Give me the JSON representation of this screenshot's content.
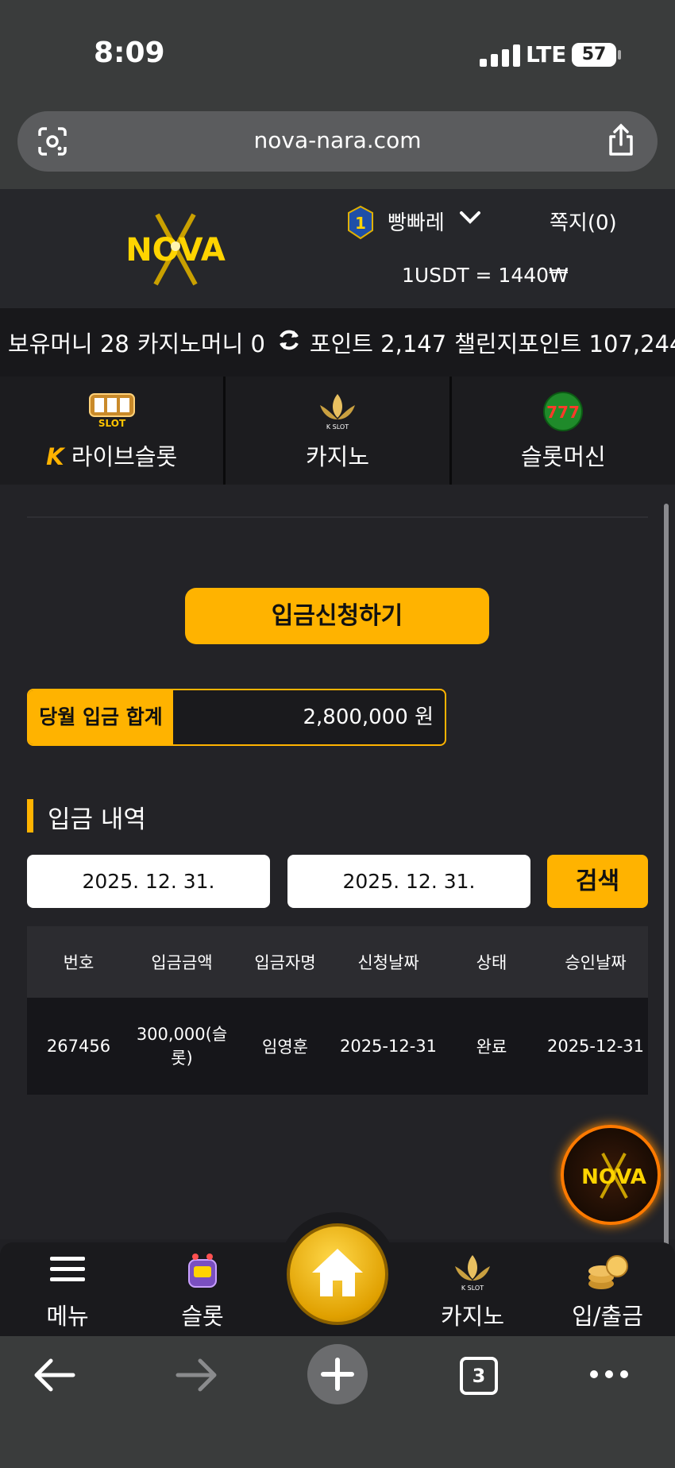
{
  "status": {
    "time": "8:09",
    "network": "LTE",
    "battery": "57"
  },
  "browser": {
    "url": "nova-nara.com",
    "tab_count": "3"
  },
  "header": {
    "logo_text": "NOVA",
    "rank": "1",
    "username": "빵빠레",
    "messages": "쪽지(0)",
    "rate": "1USDT = 1440₩"
  },
  "money": {
    "cash": "보유머니 28",
    "casino": "카지노머니 0",
    "points": "포인트 2,147",
    "challenge": "챌린지포인트 107,244"
  },
  "game_tabs": [
    {
      "label": "라이브슬롯",
      "icon": "live-slot-icon"
    },
    {
      "label": "카지노",
      "icon": "kslot-lotus-icon"
    },
    {
      "label": "슬롯머신",
      "icon": "777-slots-icon"
    }
  ],
  "deposit": {
    "apply_button": "입금신청하기",
    "month_label": "당월 입금 합계",
    "month_total": "2,800,000 원",
    "section_title": "입금 내역",
    "date_from": "2025. 12. 31.",
    "date_to": "2025. 12. 31.",
    "search_button": "검색",
    "table": {
      "headers": [
        "번호",
        "입금금액",
        "입금자명",
        "신청날짜",
        "상태",
        "승인날짜"
      ],
      "rows": [
        [
          "267456",
          "300,000(슬롯)",
          "임영훈",
          "2025-12-31",
          "완료",
          "2025-12-31"
        ]
      ]
    }
  },
  "bottom_nav": [
    {
      "label": "메뉴",
      "icon": "hamburger-icon"
    },
    {
      "label": "슬롯",
      "icon": "slot-machine-icon"
    },
    {
      "label": "",
      "icon": "home-icon"
    },
    {
      "label": "카지노",
      "icon": "kslot-lotus-icon"
    },
    {
      "label": "입/출금",
      "icon": "coins-icon"
    }
  ],
  "colors": {
    "accent": "#ffb300",
    "background": "#232327",
    "header": "#26272b"
  }
}
